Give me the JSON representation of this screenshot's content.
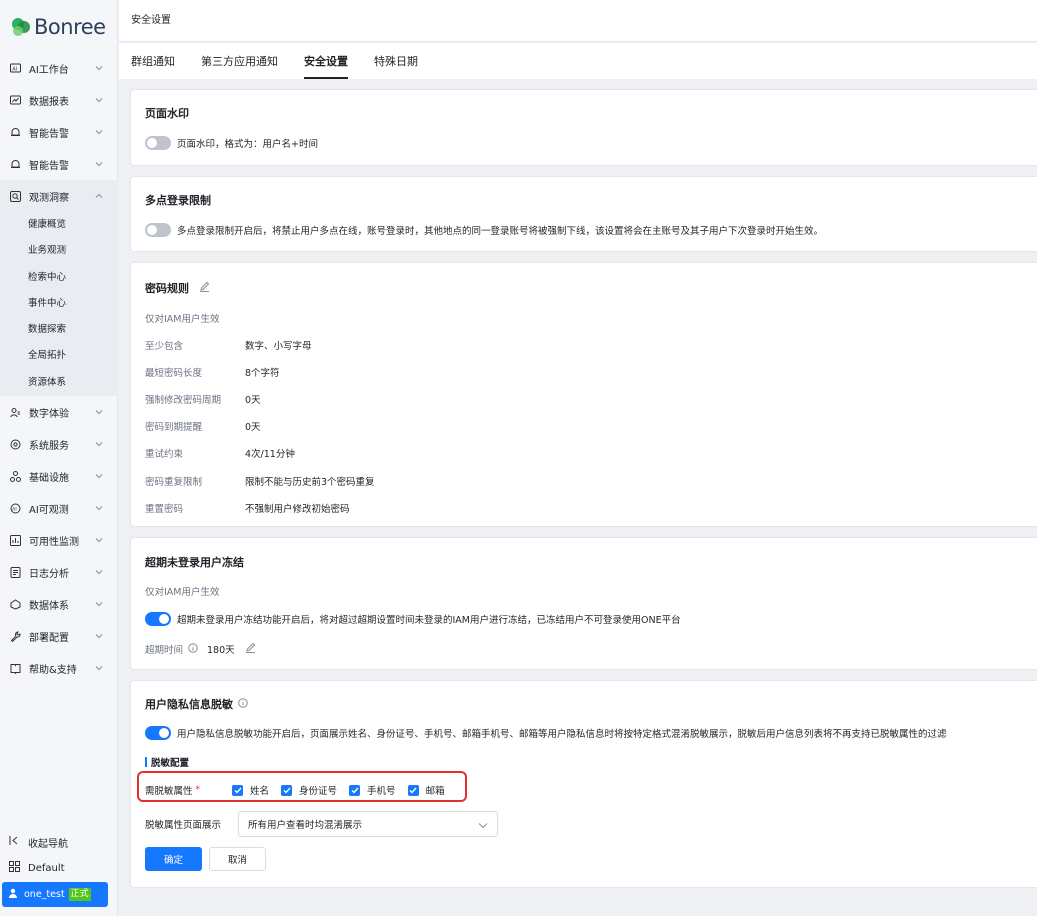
{
  "app": {
    "logo_text": "Bonree"
  },
  "sidebar": {
    "items": [
      {
        "label": "AI工作台",
        "icon": "ai-workbench-icon"
      },
      {
        "label": "数据报表",
        "icon": "report-icon"
      },
      {
        "label": "智能告警",
        "icon": "alert-icon"
      },
      {
        "label": "智能告警",
        "icon": "alert-icon"
      },
      {
        "label": "观测洞察",
        "icon": "search-icon"
      },
      {
        "label": "数字体验",
        "icon": "experience-icon"
      },
      {
        "label": "系统服务",
        "icon": "service-icon"
      },
      {
        "label": "基础设施",
        "icon": "infra-icon"
      },
      {
        "label": "AI可观测",
        "icon": "ai-observe-icon"
      },
      {
        "label": "可用性监测",
        "icon": "monitor-icon"
      },
      {
        "label": "日志分析",
        "icon": "log-icon"
      },
      {
        "label": "数据体系",
        "icon": "data-system-icon"
      },
      {
        "label": "部署配置",
        "icon": "deploy-icon"
      },
      {
        "label": "帮助&支持",
        "icon": "help-icon"
      }
    ],
    "sub_items": [
      "健康概览",
      "业务观测",
      "检索中心",
      "事件中心",
      "数据探索",
      "全局拓扑",
      "资源体系"
    ],
    "collapse_label": "收起导航",
    "workspace_label": "Default",
    "user": {
      "name": "one_test",
      "badge": "正式"
    }
  },
  "header": {
    "title": "安全设置"
  },
  "tabs": [
    {
      "label": "群组通知",
      "active": false
    },
    {
      "label": "第三方应用通知",
      "active": false
    },
    {
      "label": "安全设置",
      "active": true
    },
    {
      "label": "特殊日期",
      "active": false
    }
  ],
  "watermark": {
    "title": "页面水印",
    "enabled": false,
    "desc": "页面水印，格式为：用户名+时间"
  },
  "multi_login": {
    "title": "多点登录限制",
    "enabled": false,
    "desc": "多点登录限制开启后，将禁止用户多点在线，账号登录时，其他地点的同一登录账号将被强制下线，该设置将会在主账号及其子用户下次登录时开始生效。"
  },
  "password": {
    "title": "密码规则",
    "note": "仅对IAM用户生效",
    "rules": [
      {
        "key": "至少包含",
        "value": "数字、小写字母"
      },
      {
        "key": "最短密码长度",
        "value": "8个字符"
      },
      {
        "key": "强制修改密码周期",
        "value": "0天"
      },
      {
        "key": "密码到期提醒",
        "value": "0天"
      },
      {
        "key": "重试约束",
        "value": "4次/11分钟"
      },
      {
        "key": "密码重复限制",
        "value": "限制不能与历史前3个密码重复"
      },
      {
        "key": "重置密码",
        "value": "不强制用户修改初始密码"
      }
    ]
  },
  "freeze": {
    "title": "超期未登录用户冻结",
    "note": "仅对IAM用户生效",
    "enabled": true,
    "desc": "超期未登录用户冻结功能开启后，将对超过超期设置时间未登录的IAM用户进行冻结，已冻结用户不可登录使用ONE平台",
    "expire_label": "超期时间",
    "expire_value": "180天"
  },
  "privacy": {
    "title": "用户隐私信息脱敏",
    "enabled": true,
    "desc": "用户隐私信息脱敏功能开启后，页面展示姓名、身份证号、手机号、邮箱手机号、邮箱等用户隐私信息时将按特定格式混淆脱敏展示，脱敏后用户信息列表将不再支持已脱敏属性的过滤",
    "section_label": "脱敏配置",
    "attr_label": "需脱敏属性",
    "required_mark": "*",
    "attrs": [
      {
        "label": "姓名",
        "checked": true
      },
      {
        "label": "身份证号",
        "checked": true
      },
      {
        "label": "手机号",
        "checked": true
      },
      {
        "label": "邮箱",
        "checked": true
      }
    ],
    "display_label": "脱敏属性页面展示",
    "display_value": "所有用户查看时均混淆展示",
    "confirm": "确定",
    "cancel": "取消"
  },
  "colors": {
    "accent": "#1677ff",
    "highlight": "#e03030",
    "badge": "#52c41a"
  }
}
